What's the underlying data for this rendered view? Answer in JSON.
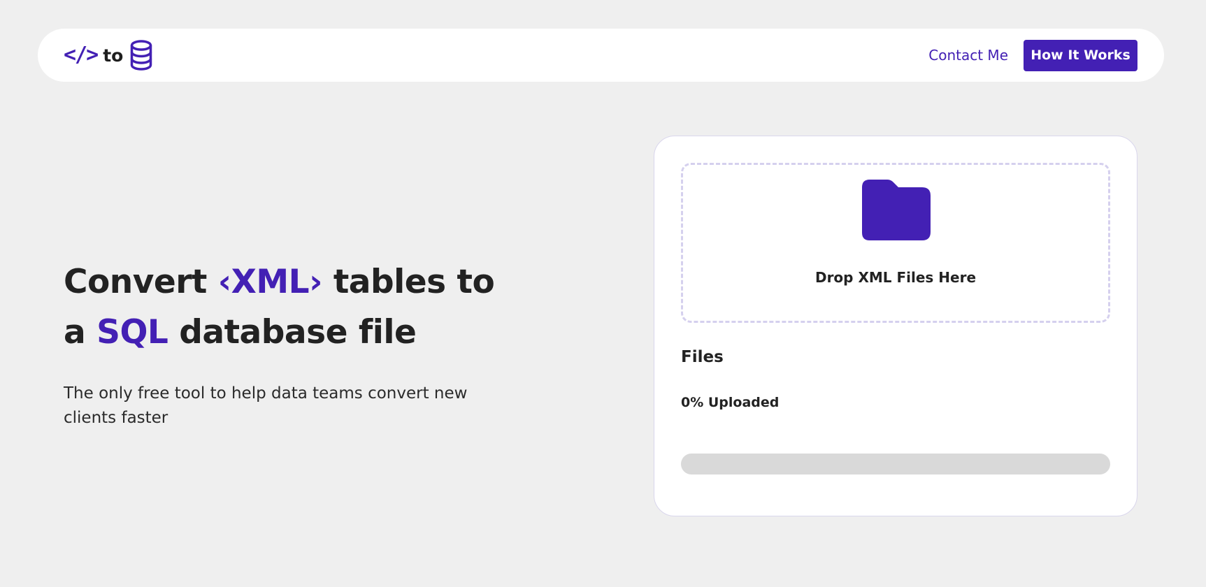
{
  "brand": {
    "code_glyph": "</>",
    "connector": "to",
    "database_icon": "database-icon",
    "accent_color": "#4320b4"
  },
  "nav": {
    "contact_label": "Contact Me",
    "how_label": "How It Works"
  },
  "hero": {
    "title_part1": "Convert ",
    "title_xml": "‹XML›",
    "title_part2": " tables to a ",
    "title_sql": "SQL",
    "title_part3": " database file",
    "subtitle": "The only free tool to help data teams convert new clients faster"
  },
  "upload": {
    "folder_icon": "folder-icon",
    "drop_label": "Drop XML Files Here",
    "files_heading": "Files",
    "status_text": "0% Uploaded",
    "progress_fraction": 0
  }
}
